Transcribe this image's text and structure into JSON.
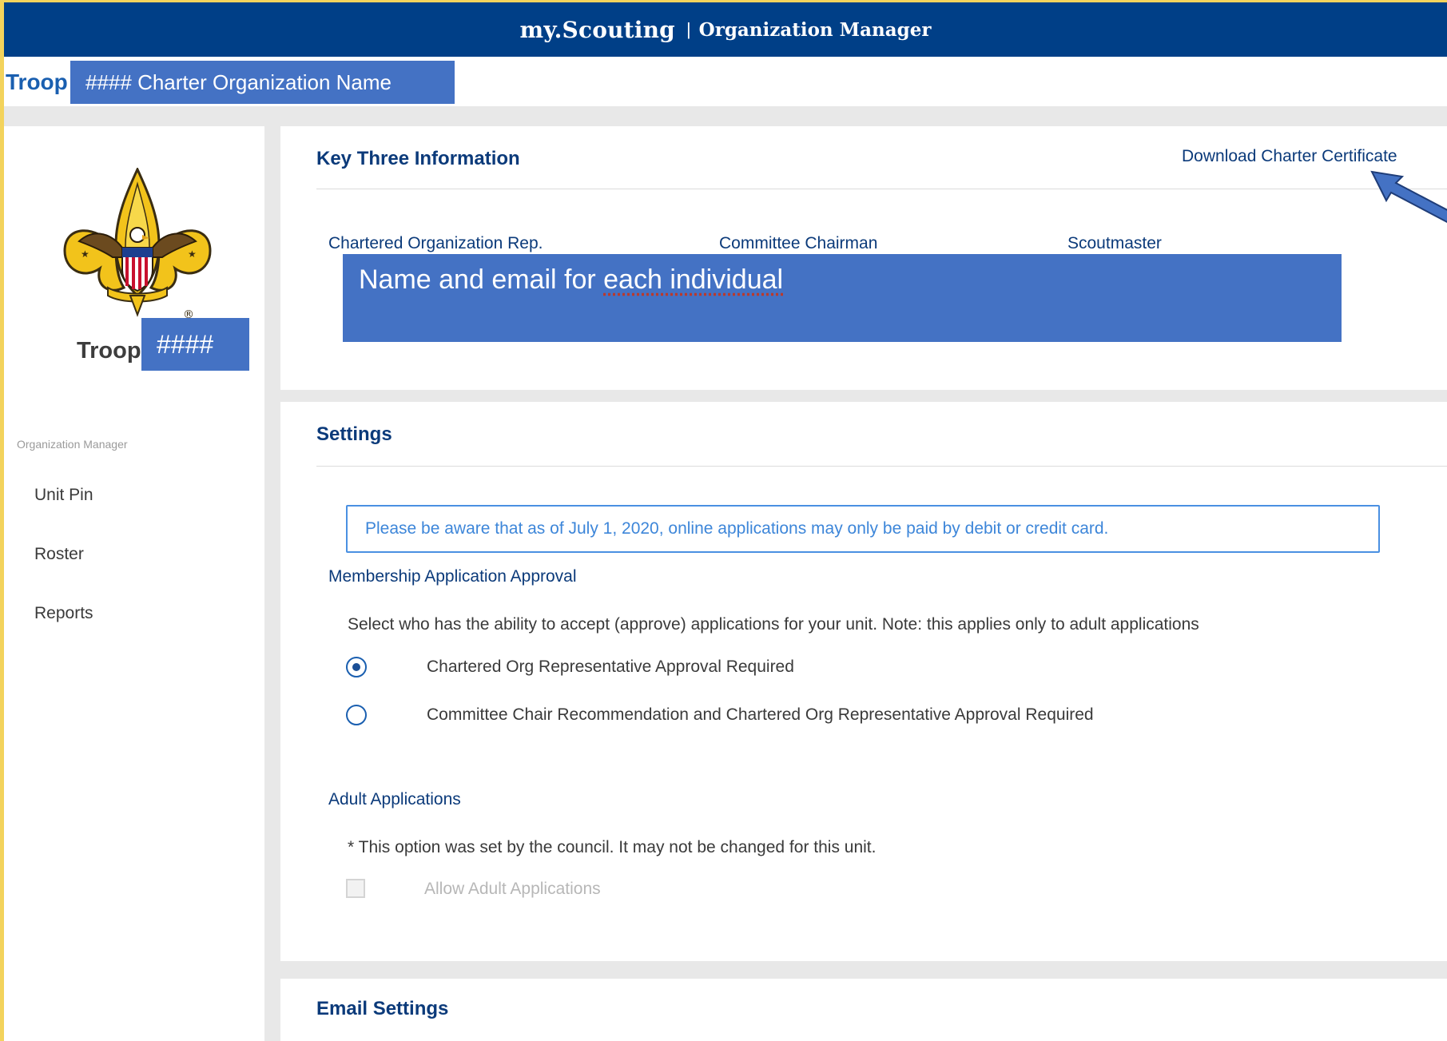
{
  "header": {
    "brand": "my.Scouting",
    "separator": "|",
    "product": "Organization Manager"
  },
  "unit_bar": {
    "troop_word": "Troop",
    "charter_overlay": "####  Charter Organization Name"
  },
  "sidebar": {
    "logo": "bsa-fleur-de-lis-logo",
    "troop_label": "Troop",
    "troop_number": "####",
    "caption": "Organization Manager",
    "items": [
      {
        "label": "Unit Pin"
      },
      {
        "label": "Roster"
      },
      {
        "label": "Reports"
      }
    ]
  },
  "key_three": {
    "title": "Key Three Information",
    "download_link": "Download Charter Certificate",
    "columns": [
      "Chartered Organization Rep.",
      "Committee Chairman",
      "Scoutmaster"
    ],
    "overlay_prefix": "Name and email for ",
    "overlay_flagged": "each individual"
  },
  "settings": {
    "title": "Settings",
    "notice": "Please be aware that as of July 1, 2020, online applications may only be paid by debit or credit card.",
    "membership_heading": "Membership Application Approval",
    "membership_desc": "Select who has the ability to accept (approve) applications for your unit. Note: this applies only to adult applications",
    "approval_options": [
      {
        "label": "Chartered Org Representative Approval Required",
        "selected": true
      },
      {
        "label": "Committee Chair Recommendation and Chartered Org Representative Approval Required",
        "selected": false
      }
    ],
    "adult_heading": "Adult Applications",
    "adult_note": "* This option was set by the council. It may not be changed for this unit.",
    "allow_adult_label": "Allow Adult Applications",
    "allow_adult_checked": false
  },
  "email_settings": {
    "title": "Email Settings"
  },
  "colors": {
    "frame": "#f3d35c",
    "header_bg": "#003f87",
    "overlay_blue": "#4472c4",
    "heading_blue": "#0b3a7a",
    "notice_blue": "#4a90e2"
  }
}
